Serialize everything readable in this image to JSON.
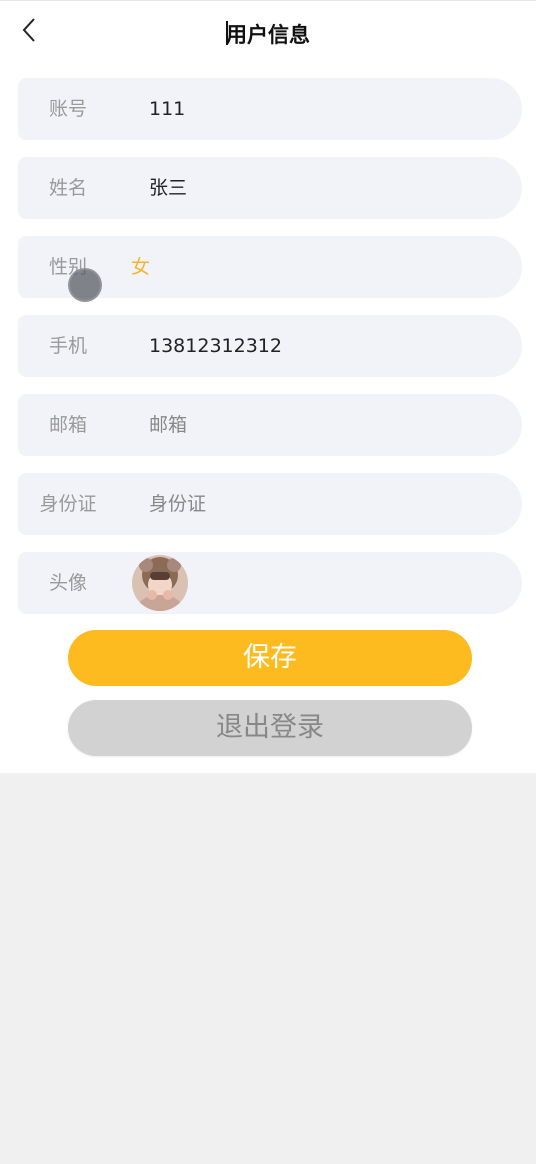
{
  "header": {
    "title": "用户信息",
    "back_icon": "chevron-left-icon"
  },
  "form": {
    "account": {
      "label": "账号",
      "value": "111"
    },
    "name": {
      "label": "姓名",
      "value": "张三"
    },
    "gender": {
      "label": "性别",
      "value": "女"
    },
    "phone": {
      "label": "手机",
      "value": "13812312312"
    },
    "email": {
      "label": "邮箱",
      "placeholder": "邮箱"
    },
    "idcard": {
      "label": "身份证",
      "placeholder": "身份证"
    },
    "avatar": {
      "label": "头像",
      "icon": "avatar-image"
    }
  },
  "buttons": {
    "save": "保存",
    "logout": "退出登录"
  },
  "colors": {
    "accent": "#fdbb1f",
    "gender_value": "#f7b52c",
    "row_bg": "#f2f3f9",
    "logout_bg": "#d2d2d2"
  }
}
